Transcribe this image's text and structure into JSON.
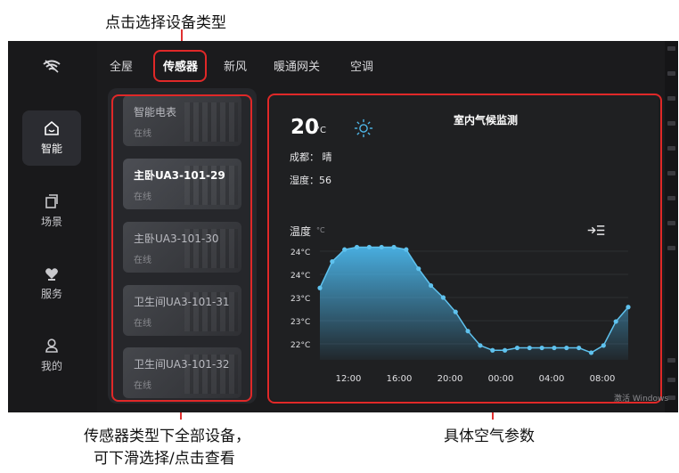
{
  "annotations": {
    "top": "点击选择设备类型",
    "left_line1": "传感器类型下全部设备，",
    "left_line2": "可下滑选择/点击查看",
    "right": "具体空气参数"
  },
  "tabs": [
    {
      "label": "全屋",
      "active": false
    },
    {
      "label": "传感器",
      "active": true
    },
    {
      "label": "新风",
      "active": false
    },
    {
      "label": "暖通网关",
      "active": false
    },
    {
      "label": "空调",
      "active": false
    }
  ],
  "sidebar": {
    "items": [
      {
        "label": "智能",
        "icon": "home-icon",
        "active": true
      },
      {
        "label": "场景",
        "icon": "scene-icon",
        "active": false
      },
      {
        "label": "服务",
        "icon": "heart-icon",
        "active": false
      },
      {
        "label": "我的",
        "icon": "user-icon",
        "active": false
      }
    ]
  },
  "devices": [
    {
      "name": "智能电表",
      "status": "在线",
      "selected": false
    },
    {
      "name": "主卧UA3-101-29",
      "status": "在线",
      "selected": true
    },
    {
      "name": "主卧UA3-101-30",
      "status": "在线",
      "selected": false
    },
    {
      "name": "卫生间UA3-101-31",
      "status": "在线",
      "selected": false
    },
    {
      "name": "卫生间UA3-101-32",
      "status": "在线",
      "selected": false
    }
  ],
  "climate": {
    "temperature": "20",
    "temp_unit": "°C",
    "title": "室内气候监测",
    "city_line": "成都： 晴",
    "humidity_line": "湿度：56",
    "chart_label": "温度",
    "chart_unit": "°C"
  },
  "windows_watermark": "激活 Windows",
  "chart_data": {
    "type": "area",
    "x_tick_labels": [
      "12:00",
      "16:00",
      "20:00",
      "00:00",
      "04:00",
      "08:00"
    ],
    "y_tick_labels": [
      "24°C",
      "24°C",
      "23°C",
      "23°C",
      "22°C"
    ],
    "ylim": [
      21.7,
      24.3
    ],
    "x": [
      0,
      1,
      2,
      3,
      4,
      5,
      6,
      7,
      8,
      9,
      10,
      11,
      12,
      13,
      14,
      15,
      16,
      17,
      18,
      19,
      20,
      21,
      22,
      23,
      24
    ],
    "values": [
      23.2,
      23.75,
      24.0,
      24.05,
      24.05,
      24.05,
      24.05,
      24.0,
      23.6,
      23.25,
      23.0,
      22.7,
      22.3,
      22.0,
      21.9,
      21.9,
      21.95,
      21.95,
      21.95,
      21.95,
      21.95,
      21.95,
      21.85,
      22.0,
      22.5,
      22.8
    ],
    "line_color": "#5fc2ee",
    "fill_color": "#4ab4e8"
  }
}
